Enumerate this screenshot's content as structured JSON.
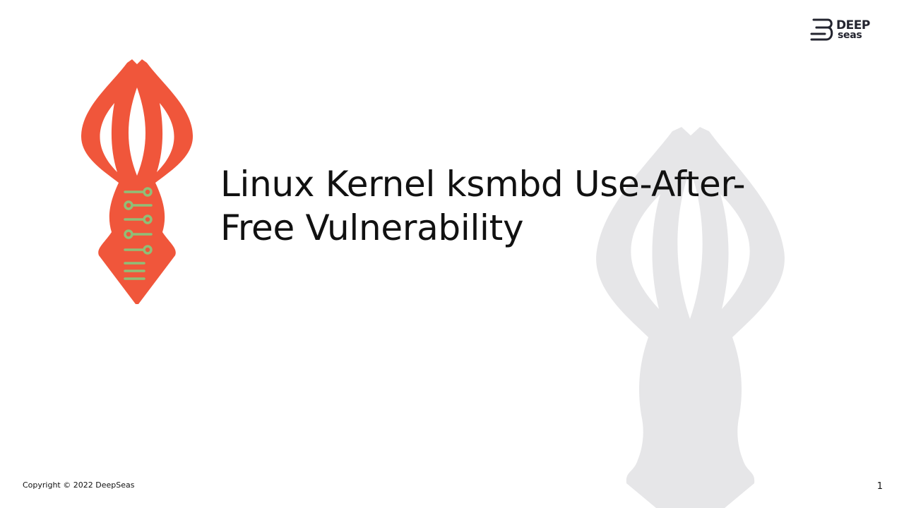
{
  "slide": {
    "title": "Linux Kernel ksmbd Use-After-Free Vulnerability",
    "copyright": "Copyright © 2022 DeepSeas",
    "page_number": "1"
  },
  "logo": {
    "word_top": "DEEP",
    "word_bottom": "seas"
  },
  "icons": {
    "main": "squid-circuit-icon",
    "background": "squid-watermark-icon",
    "brand": "deepseas-logo-icon"
  },
  "colors": {
    "squid": "#f0563b",
    "circuit": "#8fbf77",
    "watermark": "#e6e6e8",
    "logo": "#23242f"
  }
}
